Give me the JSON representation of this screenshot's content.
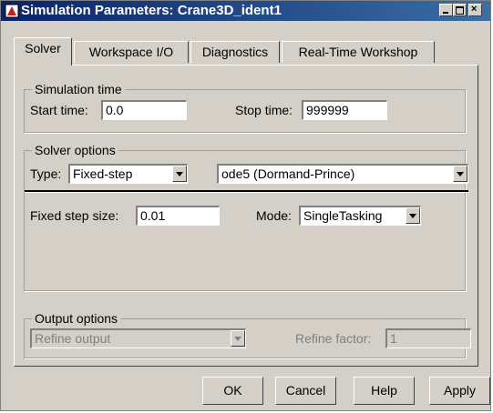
{
  "window": {
    "title": "Simulation Parameters: Crane3D_ident1"
  },
  "tabs": [
    "Solver",
    "Workspace I/O",
    "Diagnostics",
    "Real-Time Workshop"
  ],
  "active_tab": "Solver",
  "simulation_time": {
    "legend": "Simulation time",
    "start_label": "Start time:",
    "start_value": "0.0",
    "stop_label": "Stop time:",
    "stop_value": "999999"
  },
  "solver_options": {
    "legend": "Solver options",
    "type_label": "Type:",
    "type_value": "Fixed-step",
    "solver_value": "ode5 (Dormand-Prince)",
    "step_label": "Fixed step size:",
    "step_value": "0.01",
    "mode_label": "Mode:",
    "mode_value": "SingleTasking"
  },
  "output_options": {
    "legend": "Output options",
    "output_value": "Refine output",
    "refine_label": "Refine factor:",
    "refine_value": "1"
  },
  "buttons": {
    "ok": "OK",
    "cancel": "Cancel",
    "help": "Help",
    "apply": "Apply"
  },
  "colors": {
    "titlebar_start": "#0a246a",
    "titlebar_end": "#3a6ea5",
    "face": "#d4d0c8"
  },
  "icons": [
    "simulink-app-icon",
    "minimize-icon",
    "maximize-icon",
    "close-icon",
    "chevron-down-icon"
  ]
}
